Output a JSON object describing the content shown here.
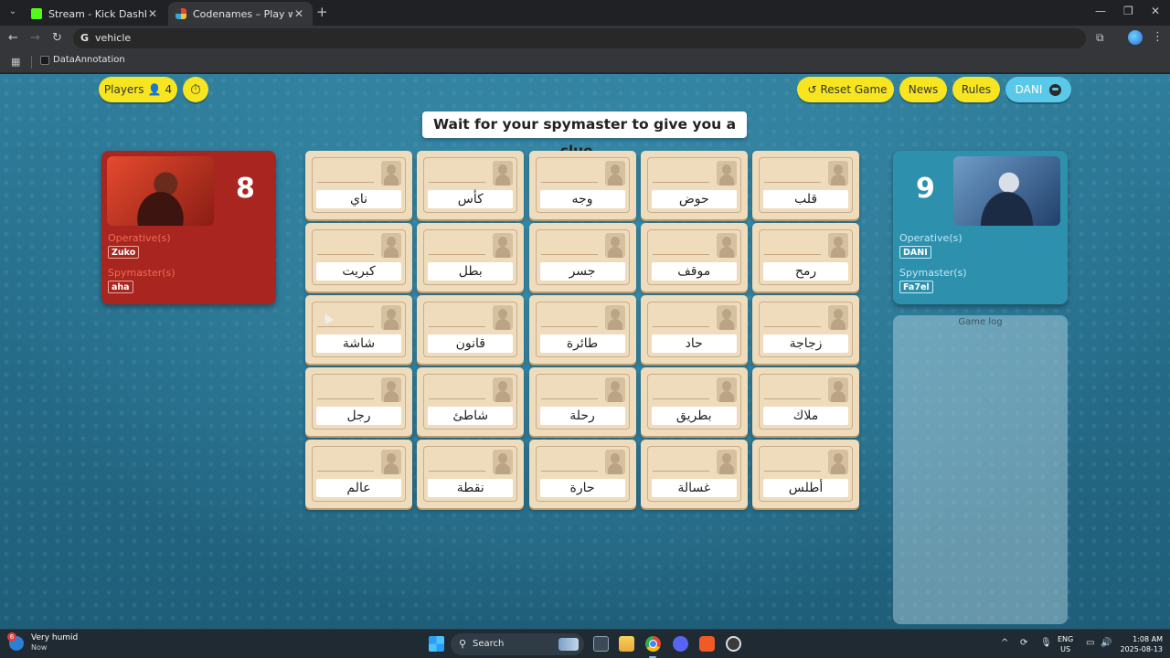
{
  "browser": {
    "tabs": [
      {
        "title": "Stream - Kick Dashboard",
        "active": false
      },
      {
        "title": "Codenames – Play with your Fri",
        "active": true
      }
    ],
    "address": "vehicle",
    "bookmark": "DataAnnotation"
  },
  "game": {
    "players_label": "Players",
    "players_count": "4",
    "reset_label": "Reset Game",
    "news_label": "News",
    "rules_label": "Rules",
    "user_name": "DANI",
    "banner": "Wait for your spymaster to give you a clue...",
    "red_team": {
      "score": "8",
      "operatives_label": "Operative(s)",
      "operative": "Zuko",
      "spymasters_label": "Spymaster(s)",
      "spymaster": "aha",
      "color": "#a8261f"
    },
    "blue_team": {
      "score": "9",
      "operatives_label": "Operative(s)",
      "operative": "DANI",
      "spymasters_label": "Spymaster(s)",
      "spymaster": "Fa7el",
      "color": "#2d90ad"
    },
    "game_log_label": "Game log",
    "cards": [
      "ناي",
      "كأس",
      "وجه",
      "حوض",
      "قلب",
      "كبريت",
      "بطل",
      "جسر",
      "موقف",
      "رمح",
      "شاشة",
      "قانون",
      "طائرة",
      "حاد",
      "زجاجة",
      "رجل",
      "شاطئ",
      "رحلة",
      "بطريق",
      "ملاك",
      "عالم",
      "نقطة",
      "حارة",
      "غسالة",
      "أطلس"
    ]
  },
  "taskbar": {
    "weather": "Very humid",
    "weather_sub": "Now",
    "weather_badge": "6",
    "search": "Search",
    "lang": "ENG",
    "region": "US",
    "time": "1:08 AM",
    "date": "2025-08-13"
  }
}
